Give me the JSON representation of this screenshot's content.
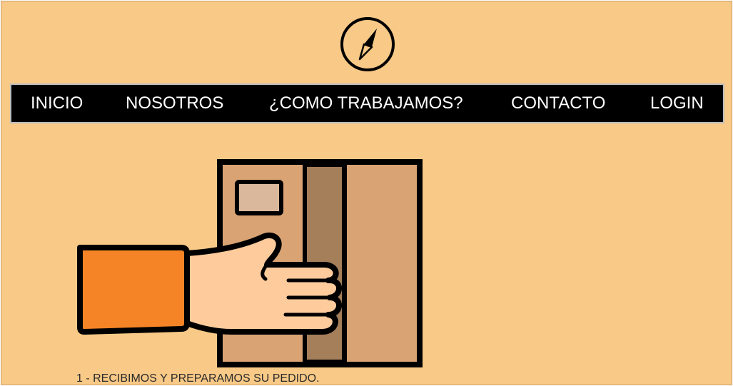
{
  "header": {
    "logo_icon": "compass-icon"
  },
  "nav": {
    "items": [
      {
        "label": "INICIO"
      },
      {
        "label": "NOSOTROS"
      },
      {
        "label": "¿COMO TRABAJAMOS?"
      },
      {
        "label": "CONTACTO"
      },
      {
        "label": "LOGIN"
      }
    ]
  },
  "main": {
    "step_caption": "1 - RECIBIMOS Y PREPARAMOS SU PEDIDO.",
    "illustration_icon": "hand-holding-package-icon"
  },
  "colors": {
    "background": "#f8c987",
    "nav_background": "#000000",
    "nav_text": "#ffffff",
    "sleeve": "#f58426",
    "hand": "#fdcb9c",
    "box": "#d9a374",
    "tape": "#a57e5a",
    "label": "#d9b89b"
  }
}
